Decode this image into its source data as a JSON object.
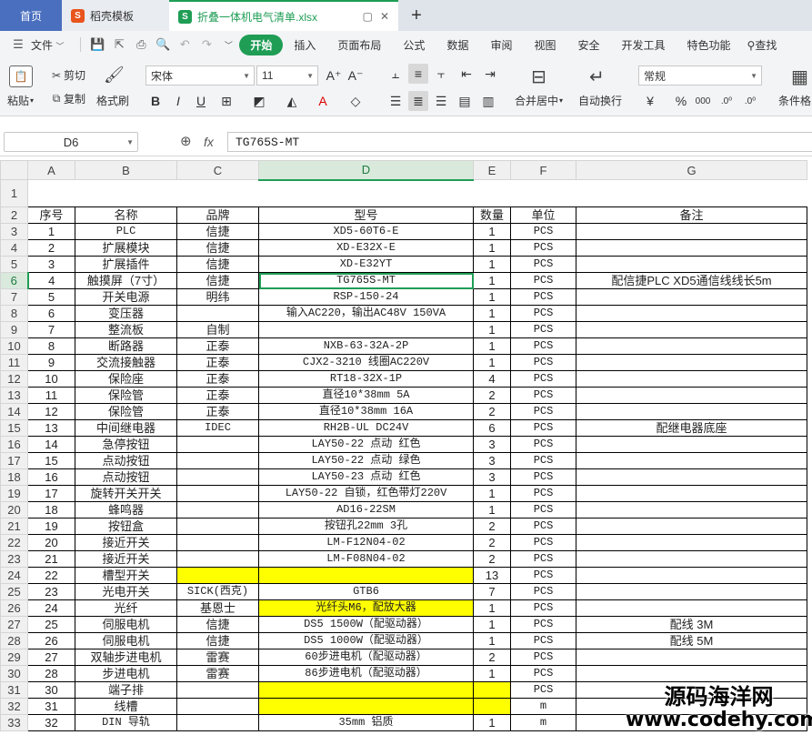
{
  "tabs": {
    "home": "首页",
    "template": "稻壳模板",
    "file": "折叠一体机电气清单.xlsx",
    "add": "+"
  },
  "menu": {
    "file": "文件",
    "items": [
      "开始",
      "插入",
      "页面布局",
      "公式",
      "数据",
      "审阅",
      "视图",
      "安全",
      "开发工具",
      "特色功能"
    ],
    "search": "查找"
  },
  "ribbon": {
    "paste": "粘贴",
    "cut": "剪切",
    "copy": "复制",
    "format_painter": "格式刷",
    "font_name": "宋体",
    "font_size": "11",
    "merge_center": "合并居中",
    "wrap_text": "自动换行",
    "number_format": "常规",
    "conditional_format": "条件格"
  },
  "formula": {
    "cell_ref": "D6",
    "fx": "fx",
    "value": "TG765S-MT"
  },
  "columns": [
    "A",
    "B",
    "C",
    "D",
    "E",
    "F",
    "G"
  ],
  "header_row": [
    "序号",
    "名称",
    "品牌",
    "型号",
    "数量",
    "单位",
    "备注"
  ],
  "rows": [
    {
      "n": "3",
      "a": "1",
      "b": "PLC",
      "c": "信捷",
      "d": "XD5-60T6-E",
      "e": "1",
      "f": "PCS",
      "g": ""
    },
    {
      "n": "4",
      "a": "2",
      "b": "扩展模块",
      "c": "信捷",
      "d": "XD-E32X-E",
      "e": "1",
      "f": "PCS",
      "g": ""
    },
    {
      "n": "5",
      "a": "3",
      "b": "扩展插件",
      "c": "信捷",
      "d": "XD-E32YT",
      "e": "1",
      "f": "PCS",
      "g": ""
    },
    {
      "n": "6",
      "a": "4",
      "b": "触摸屏（7寸）",
      "c": "信捷",
      "d": "TG765S-MT",
      "e": "1",
      "f": "PCS",
      "g": "配信捷PLC XD5通信线线长5m"
    },
    {
      "n": "7",
      "a": "5",
      "b": "开关电源",
      "c": "明纬",
      "d": "RSP-150-24",
      "e": "1",
      "f": "PCS",
      "g": ""
    },
    {
      "n": "8",
      "a": "6",
      "b": "变压器",
      "c": "",
      "d": "输入AC220，输出AC48V 150VA",
      "e": "1",
      "f": "PCS",
      "g": ""
    },
    {
      "n": "9",
      "a": "7",
      "b": "整流板",
      "c": "自制",
      "d": "",
      "e": "1",
      "f": "PCS",
      "g": ""
    },
    {
      "n": "10",
      "a": "8",
      "b": "断路器",
      "c": "正泰",
      "d": "NXB-63-32A-2P",
      "e": "1",
      "f": "PCS",
      "g": ""
    },
    {
      "n": "11",
      "a": "9",
      "b": "交流接触器",
      "c": "正泰",
      "d": "CJX2-3210  线圈AC220V",
      "e": "1",
      "f": "PCS",
      "g": ""
    },
    {
      "n": "12",
      "a": "10",
      "b": "保险座",
      "c": "正泰",
      "d": "RT18-32X-1P",
      "e": "4",
      "f": "PCS",
      "g": ""
    },
    {
      "n": "13",
      "a": "11",
      "b": "保险管",
      "c": "正泰",
      "d": "直径10*38mm 5A",
      "e": "2",
      "f": "PCS",
      "g": ""
    },
    {
      "n": "14",
      "a": "12",
      "b": "保险管",
      "c": "正泰",
      "d": "直径10*38mm 16A",
      "e": "2",
      "f": "PCS",
      "g": ""
    },
    {
      "n": "15",
      "a": "13",
      "b": "中间继电器",
      "c": "IDEC",
      "d": "RH2B-UL DC24V",
      "e": "6",
      "f": "PCS",
      "g": "配继电器底座"
    },
    {
      "n": "16",
      "a": "14",
      "b": "急停按钮",
      "c": "",
      "d": "LAY50-22 点动 红色",
      "e": "3",
      "f": "PCS",
      "g": ""
    },
    {
      "n": "17",
      "a": "15",
      "b": "点动按钮",
      "c": "",
      "d": "LAY50-22 点动 绿色",
      "e": "3",
      "f": "PCS",
      "g": ""
    },
    {
      "n": "18",
      "a": "16",
      "b": "点动按钮",
      "c": "",
      "d": "LAY50-23 点动 红色",
      "e": "3",
      "f": "PCS",
      "g": ""
    },
    {
      "n": "19",
      "a": "17",
      "b": "旋转开关开关",
      "c": "",
      "d": "LAY50-22 自锁，红色带灯220V",
      "e": "1",
      "f": "PCS",
      "g": ""
    },
    {
      "n": "20",
      "a": "18",
      "b": "蜂鸣器",
      "c": "",
      "d": "AD16-22SM",
      "e": "1",
      "f": "PCS",
      "g": ""
    },
    {
      "n": "21",
      "a": "19",
      "b": "按钮盒",
      "c": "",
      "d": "按钮孔22mm 3孔",
      "e": "2",
      "f": "PCS",
      "g": ""
    },
    {
      "n": "22",
      "a": "20",
      "b": "接近开关",
      "c": "",
      "d": "LM-F12N04-02",
      "e": "2",
      "f": "PCS",
      "g": ""
    },
    {
      "n": "23",
      "a": "21",
      "b": "接近开关",
      "c": "",
      "d": "LM-F08N04-02",
      "e": "2",
      "f": "PCS",
      "g": ""
    },
    {
      "n": "24",
      "a": "22",
      "b": "槽型开关",
      "c": "",
      "d": "",
      "e": "13",
      "f": "PCS",
      "g": ""
    },
    {
      "n": "25",
      "a": "23",
      "b": "光电开关",
      "c": "SICK(西克)",
      "d": "GTB6",
      "e": "7",
      "f": "PCS",
      "g": ""
    },
    {
      "n": "26",
      "a": "24",
      "b": "光纤",
      "c": "基恩士",
      "d": "光纤头M6，配放大器",
      "e": "1",
      "f": "PCS",
      "g": ""
    },
    {
      "n": "27",
      "a": "25",
      "b": "伺服电机",
      "c": "信捷",
      "d": "DS5   1500W（配驱动器）",
      "e": "1",
      "f": "PCS",
      "g": "配线 3M"
    },
    {
      "n": "28",
      "a": "26",
      "b": "伺服电机",
      "c": "信捷",
      "d": "DS5   1000W（配驱动器）",
      "e": "1",
      "f": "PCS",
      "g": "配线 5M"
    },
    {
      "n": "29",
      "a": "27",
      "b": "双轴步进电机",
      "c": "雷赛",
      "d": "60步进电机（配驱动器）",
      "e": "2",
      "f": "PCS",
      "g": ""
    },
    {
      "n": "30",
      "a": "28",
      "b": "步进电机",
      "c": "雷赛",
      "d": "86步进电机（配驱动器）",
      "e": "1",
      "f": "PCS",
      "g": ""
    },
    {
      "n": "31",
      "a": "30",
      "b": "端子排",
      "c": "",
      "d": "",
      "e": "",
      "f": "PCS",
      "g": ""
    },
    {
      "n": "32",
      "a": "31",
      "b": "线槽",
      "c": "",
      "d": "",
      "e": "",
      "f": "m",
      "g": ""
    },
    {
      "n": "33",
      "a": "32",
      "b": "DIN 导轨",
      "c": "",
      "d": "35mm 铝质",
      "e": "1",
      "f": "m",
      "g": ""
    }
  ],
  "highlight_color": "#ffff00",
  "accent_color": "#1f9d55",
  "watermark": {
    "line1": "源码海洋网",
    "line2": "www.codehy.com"
  }
}
